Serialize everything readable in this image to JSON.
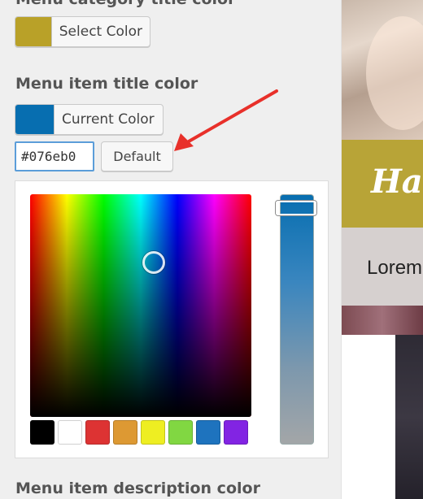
{
  "sections": {
    "category": {
      "title": "Menu category title color",
      "button_label": "Select Color",
      "swatch_color": "#b9a128"
    },
    "item": {
      "title": "Menu item title color",
      "button_label": "Current Color",
      "swatch_color": "#076eb0",
      "hex_value": "#076eb0",
      "default_label": "Default"
    },
    "description": {
      "title": "Menu item description color"
    }
  },
  "palette": [
    "#000000",
    "#ffffff",
    "#dd3333",
    "#dd9933",
    "#eeee22",
    "#81d742",
    "#1e73be",
    "#8224e3"
  ],
  "preview": {
    "brand_text": "Ha",
    "lorem_text": "Lorem"
  },
  "colors": {
    "accent": "#076eb0",
    "annotation_arrow": "#e8302a"
  }
}
